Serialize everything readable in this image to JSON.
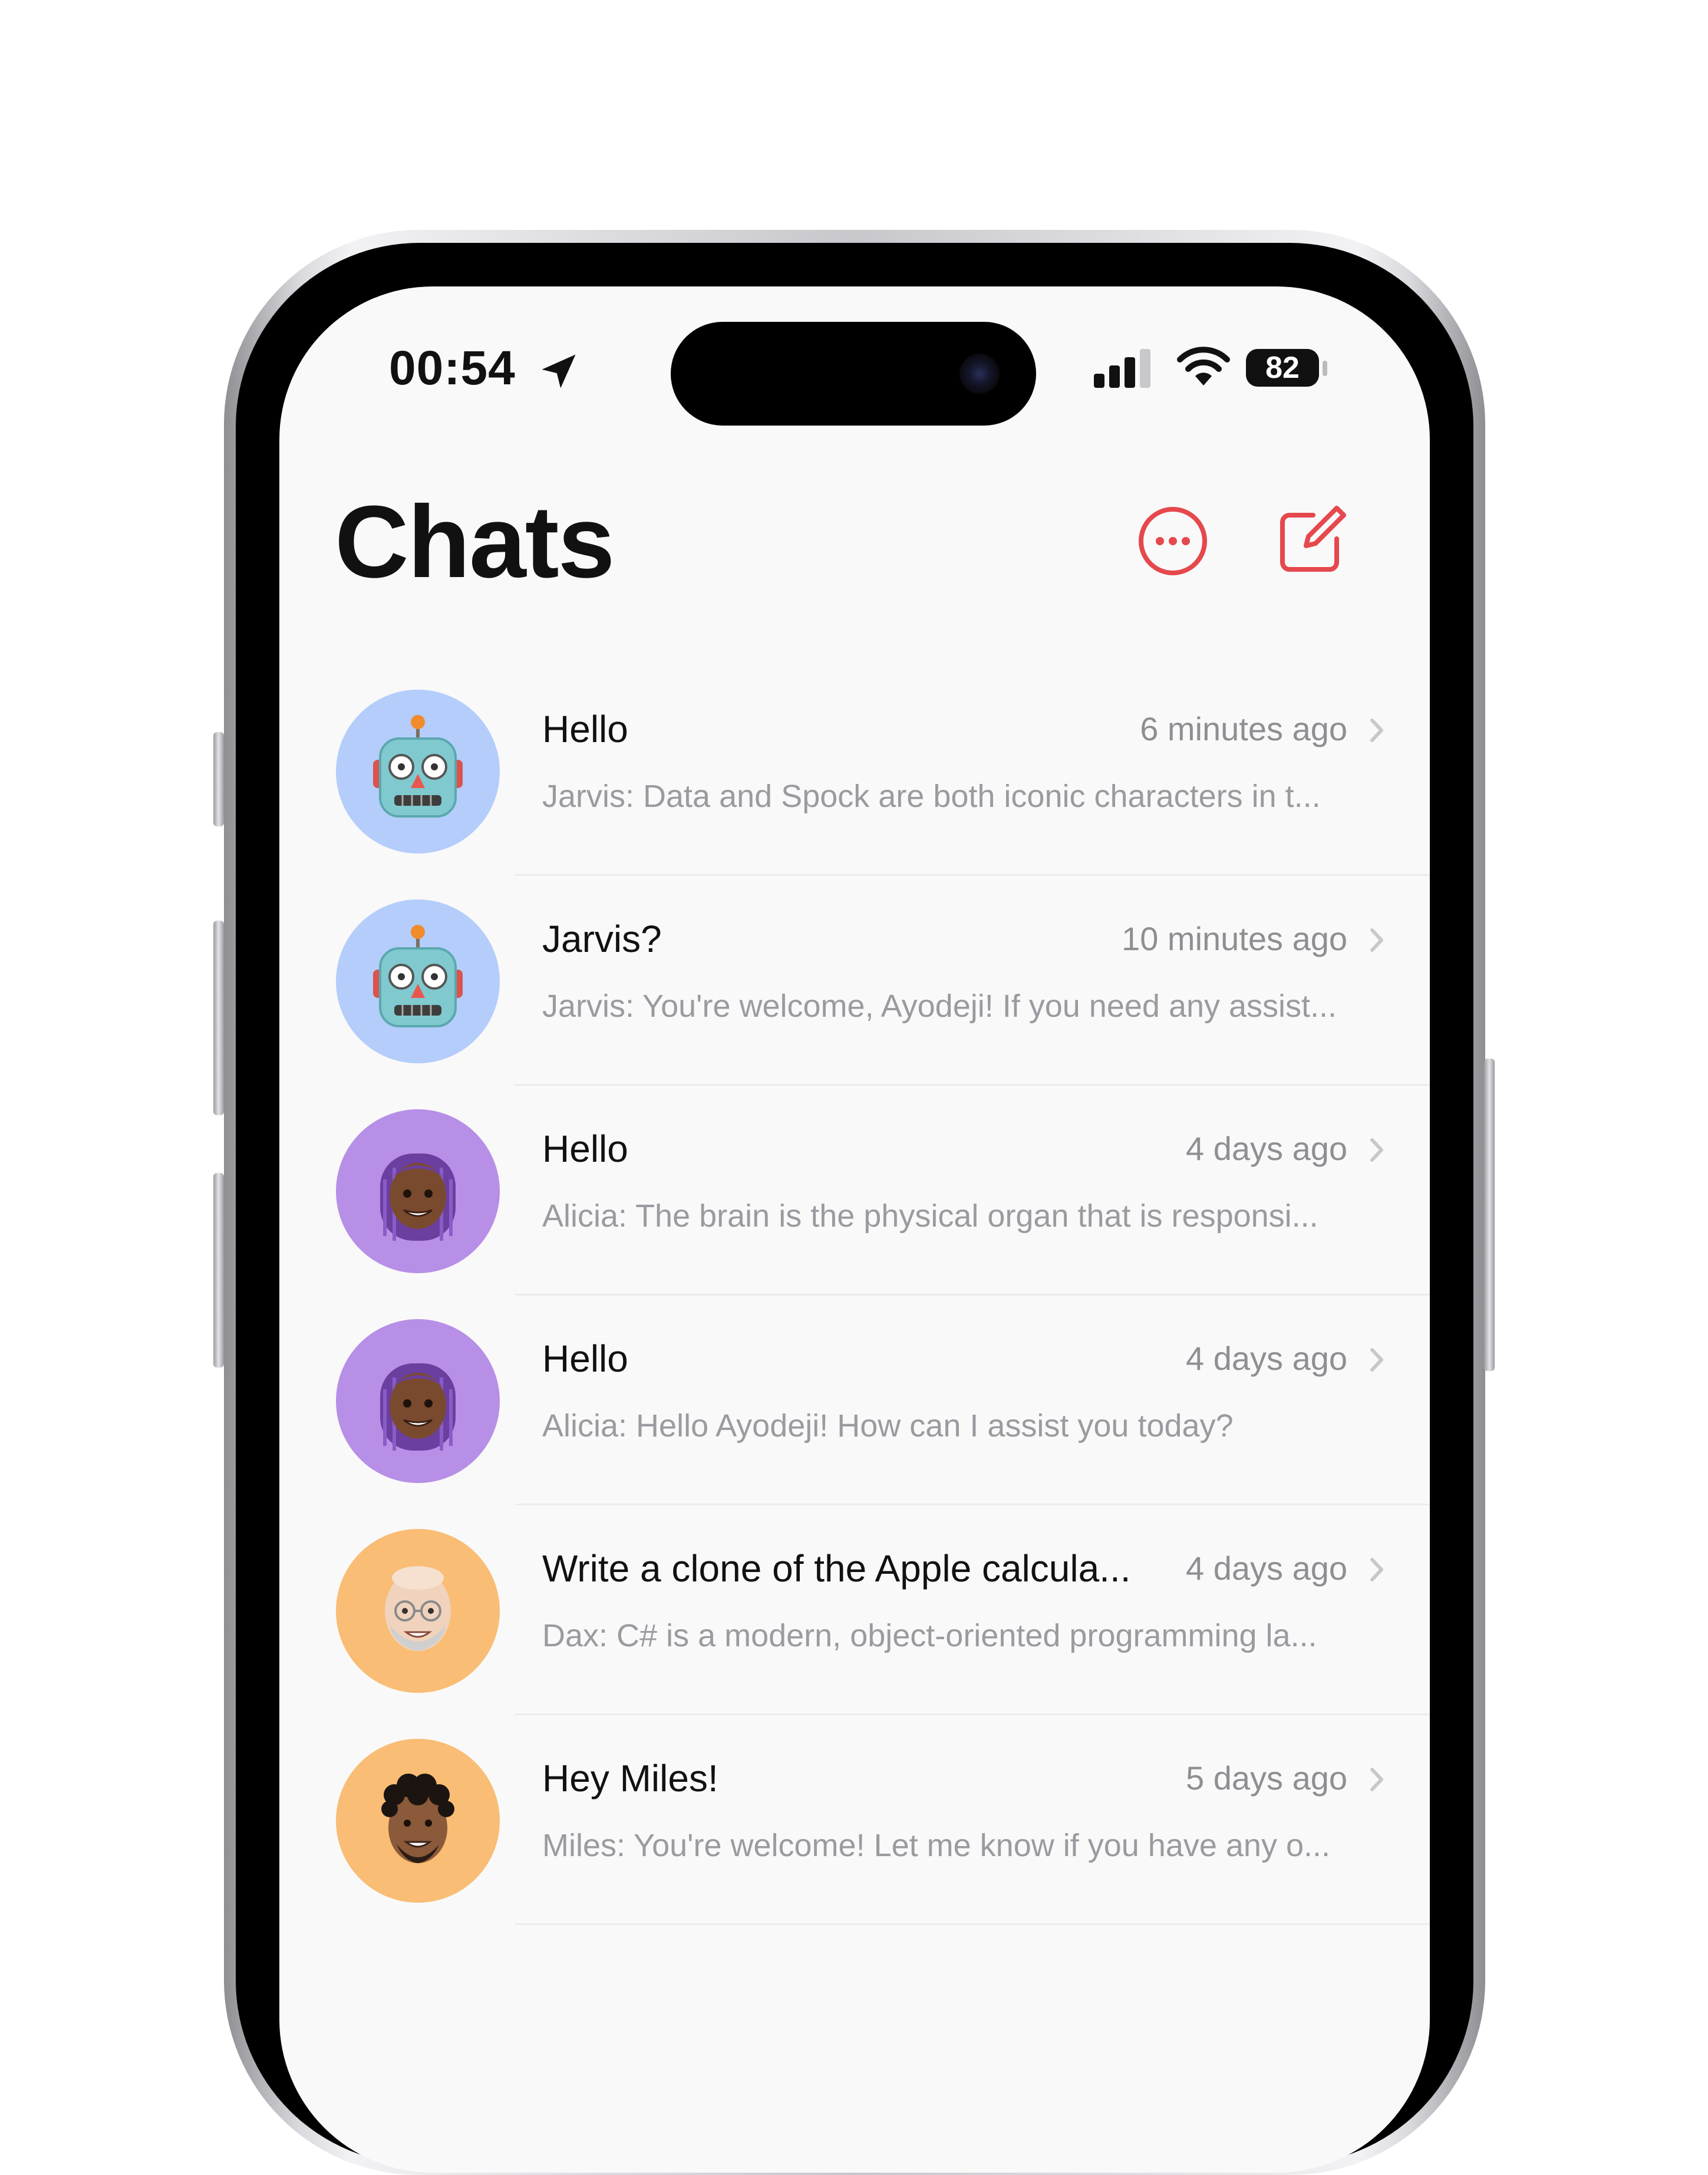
{
  "status_bar": {
    "time": "00:54",
    "battery": "82",
    "icons": [
      "location-arrow-icon",
      "cellular-signal-icon",
      "wifi-icon",
      "battery-icon"
    ]
  },
  "header": {
    "title": "Chats",
    "more_icon": "ellipsis-circle-icon",
    "compose_icon": "compose-icon"
  },
  "colors": {
    "accent": "#e5484d",
    "avatar_blue": "#b4cdfb",
    "avatar_purple": "#b78fe6",
    "avatar_orange": "#f9bd75"
  },
  "chats": [
    {
      "title": "Hello",
      "time": "6 minutes ago",
      "preview": "Jarvis: Data and Spock are both iconic characters in t...",
      "avatar": "robot",
      "avatar_color": "#b4cdfb"
    },
    {
      "title": "Jarvis?",
      "time": "10 minutes ago",
      "preview": "Jarvis: You're welcome, Ayodeji! If you need any assist...",
      "avatar": "robot",
      "avatar_color": "#b4cdfb"
    },
    {
      "title": "Hello",
      "time": "4 days ago",
      "preview": "Alicia: The brain is the physical organ that is responsi...",
      "avatar": "woman-purple-hair",
      "avatar_color": "#b78fe6"
    },
    {
      "title": "Hello",
      "time": "4 days ago",
      "preview": "Alicia: Hello Ayodeji! How can I assist you today?",
      "avatar": "woman-purple-hair",
      "avatar_color": "#b78fe6"
    },
    {
      "title": "Write a clone of the Apple calcula...",
      "time": "4 days ago",
      "preview": "Dax: C# is a modern, object-oriented programming la...",
      "avatar": "bald-man-glasses",
      "avatar_color": "#f9bd75"
    },
    {
      "title": "Hey Miles!",
      "time": "5 days ago",
      "preview": "Miles: You're welcome! Let me know if you have any o...",
      "avatar": "man-curly-hair",
      "avatar_color": "#f9bd75"
    }
  ]
}
